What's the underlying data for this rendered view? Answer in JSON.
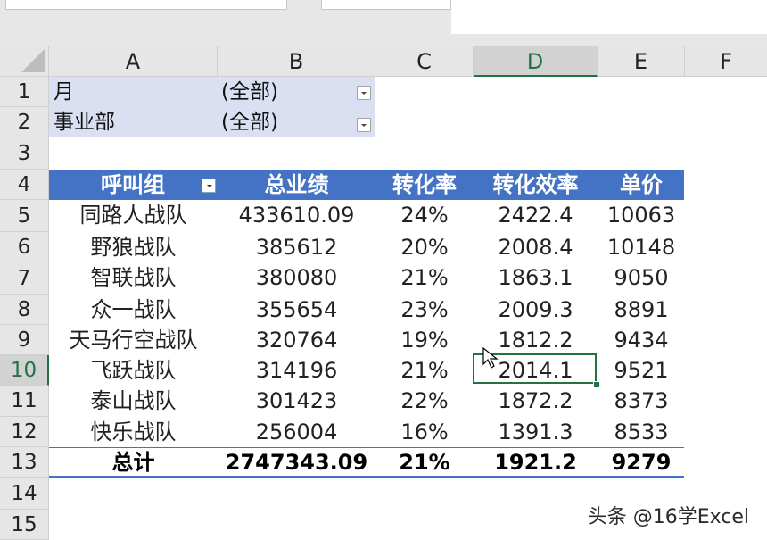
{
  "columns": [
    "A",
    "B",
    "C",
    "D",
    "E",
    "F"
  ],
  "rows": [
    "1",
    "2",
    "3",
    "4",
    "5",
    "6",
    "7",
    "8",
    "9",
    "10",
    "11",
    "12",
    "13",
    "14",
    "15"
  ],
  "filters": [
    {
      "label": "月",
      "value": "(全部)"
    },
    {
      "label": "事业部",
      "value": "(全部)"
    }
  ],
  "headers": [
    "呼叫组",
    "总业绩",
    "转化率",
    "转化效率",
    "单价"
  ],
  "table": [
    [
      "同路人战队",
      "433610.09",
      "24%",
      "2422.4",
      "10063"
    ],
    [
      "野狼战队",
      "385612",
      "20%",
      "2008.4",
      "10148"
    ],
    [
      "智联战队",
      "380080",
      "21%",
      "1863.1",
      "9050"
    ],
    [
      "众一战队",
      "355654",
      "23%",
      "2009.3",
      "8891"
    ],
    [
      "天马行空战队",
      "320764",
      "19%",
      "1812.2",
      "9434"
    ],
    [
      "飞跃战队",
      "314196",
      "21%",
      "2014.1",
      "9521"
    ],
    [
      "泰山战队",
      "301423",
      "22%",
      "1872.2",
      "8373"
    ],
    [
      "快乐战队",
      "256004",
      "16%",
      "1391.3",
      "8533"
    ]
  ],
  "total": [
    "总计",
    "2747343.09",
    "21%",
    "1921.2",
    "9279"
  ],
  "selected_cell": "D10",
  "watermark": "头条 @16学Excel",
  "icons": {
    "corner": "select-all-triangle",
    "filter": "dropdown-arrow-icon",
    "cursor": "move-cursor-icon"
  },
  "colors": {
    "header": "#4472c4",
    "filter_bg": "#dae0f2",
    "selection": "#217346",
    "gridline": "#cfcfcf"
  }
}
